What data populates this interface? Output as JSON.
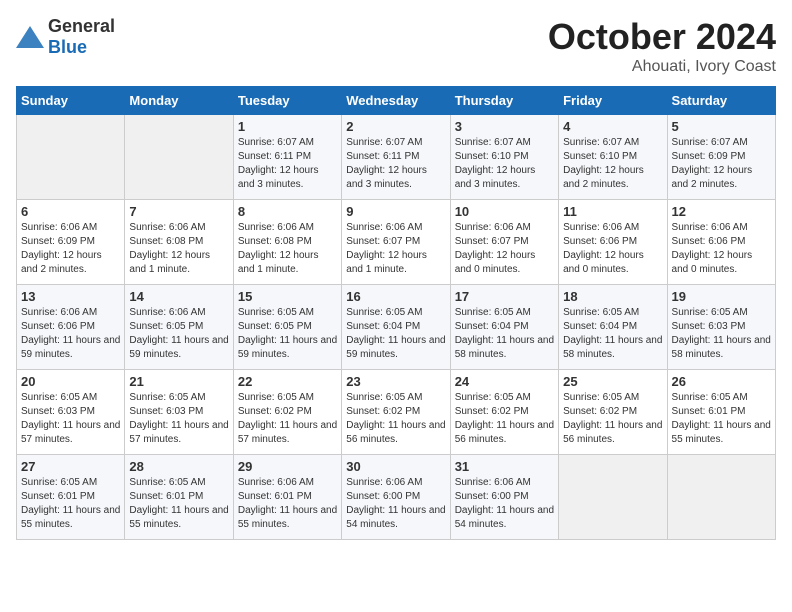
{
  "logo": {
    "general": "General",
    "blue": "Blue"
  },
  "header": {
    "month": "October 2024",
    "location": "Ahouati, Ivory Coast"
  },
  "weekdays": [
    "Sunday",
    "Monday",
    "Tuesday",
    "Wednesday",
    "Thursday",
    "Friday",
    "Saturday"
  ],
  "weeks": [
    [
      {
        "day": "",
        "info": ""
      },
      {
        "day": "",
        "info": ""
      },
      {
        "day": "1",
        "info": "Sunrise: 6:07 AM\nSunset: 6:11 PM\nDaylight: 12 hours and 3 minutes."
      },
      {
        "day": "2",
        "info": "Sunrise: 6:07 AM\nSunset: 6:11 PM\nDaylight: 12 hours and 3 minutes."
      },
      {
        "day": "3",
        "info": "Sunrise: 6:07 AM\nSunset: 6:10 PM\nDaylight: 12 hours and 3 minutes."
      },
      {
        "day": "4",
        "info": "Sunrise: 6:07 AM\nSunset: 6:10 PM\nDaylight: 12 hours and 2 minutes."
      },
      {
        "day": "5",
        "info": "Sunrise: 6:07 AM\nSunset: 6:09 PM\nDaylight: 12 hours and 2 minutes."
      }
    ],
    [
      {
        "day": "6",
        "info": "Sunrise: 6:06 AM\nSunset: 6:09 PM\nDaylight: 12 hours and 2 minutes."
      },
      {
        "day": "7",
        "info": "Sunrise: 6:06 AM\nSunset: 6:08 PM\nDaylight: 12 hours and 1 minute."
      },
      {
        "day": "8",
        "info": "Sunrise: 6:06 AM\nSunset: 6:08 PM\nDaylight: 12 hours and 1 minute."
      },
      {
        "day": "9",
        "info": "Sunrise: 6:06 AM\nSunset: 6:07 PM\nDaylight: 12 hours and 1 minute."
      },
      {
        "day": "10",
        "info": "Sunrise: 6:06 AM\nSunset: 6:07 PM\nDaylight: 12 hours and 0 minutes."
      },
      {
        "day": "11",
        "info": "Sunrise: 6:06 AM\nSunset: 6:06 PM\nDaylight: 12 hours and 0 minutes."
      },
      {
        "day": "12",
        "info": "Sunrise: 6:06 AM\nSunset: 6:06 PM\nDaylight: 12 hours and 0 minutes."
      }
    ],
    [
      {
        "day": "13",
        "info": "Sunrise: 6:06 AM\nSunset: 6:06 PM\nDaylight: 11 hours and 59 minutes."
      },
      {
        "day": "14",
        "info": "Sunrise: 6:06 AM\nSunset: 6:05 PM\nDaylight: 11 hours and 59 minutes."
      },
      {
        "day": "15",
        "info": "Sunrise: 6:05 AM\nSunset: 6:05 PM\nDaylight: 11 hours and 59 minutes."
      },
      {
        "day": "16",
        "info": "Sunrise: 6:05 AM\nSunset: 6:04 PM\nDaylight: 11 hours and 59 minutes."
      },
      {
        "day": "17",
        "info": "Sunrise: 6:05 AM\nSunset: 6:04 PM\nDaylight: 11 hours and 58 minutes."
      },
      {
        "day": "18",
        "info": "Sunrise: 6:05 AM\nSunset: 6:04 PM\nDaylight: 11 hours and 58 minutes."
      },
      {
        "day": "19",
        "info": "Sunrise: 6:05 AM\nSunset: 6:03 PM\nDaylight: 11 hours and 58 minutes."
      }
    ],
    [
      {
        "day": "20",
        "info": "Sunrise: 6:05 AM\nSunset: 6:03 PM\nDaylight: 11 hours and 57 minutes."
      },
      {
        "day": "21",
        "info": "Sunrise: 6:05 AM\nSunset: 6:03 PM\nDaylight: 11 hours and 57 minutes."
      },
      {
        "day": "22",
        "info": "Sunrise: 6:05 AM\nSunset: 6:02 PM\nDaylight: 11 hours and 57 minutes."
      },
      {
        "day": "23",
        "info": "Sunrise: 6:05 AM\nSunset: 6:02 PM\nDaylight: 11 hours and 56 minutes."
      },
      {
        "day": "24",
        "info": "Sunrise: 6:05 AM\nSunset: 6:02 PM\nDaylight: 11 hours and 56 minutes."
      },
      {
        "day": "25",
        "info": "Sunrise: 6:05 AM\nSunset: 6:02 PM\nDaylight: 11 hours and 56 minutes."
      },
      {
        "day": "26",
        "info": "Sunrise: 6:05 AM\nSunset: 6:01 PM\nDaylight: 11 hours and 55 minutes."
      }
    ],
    [
      {
        "day": "27",
        "info": "Sunrise: 6:05 AM\nSunset: 6:01 PM\nDaylight: 11 hours and 55 minutes."
      },
      {
        "day": "28",
        "info": "Sunrise: 6:05 AM\nSunset: 6:01 PM\nDaylight: 11 hours and 55 minutes."
      },
      {
        "day": "29",
        "info": "Sunrise: 6:06 AM\nSunset: 6:01 PM\nDaylight: 11 hours and 55 minutes."
      },
      {
        "day": "30",
        "info": "Sunrise: 6:06 AM\nSunset: 6:00 PM\nDaylight: 11 hours and 54 minutes."
      },
      {
        "day": "31",
        "info": "Sunrise: 6:06 AM\nSunset: 6:00 PM\nDaylight: 11 hours and 54 minutes."
      },
      {
        "day": "",
        "info": ""
      },
      {
        "day": "",
        "info": ""
      }
    ]
  ]
}
